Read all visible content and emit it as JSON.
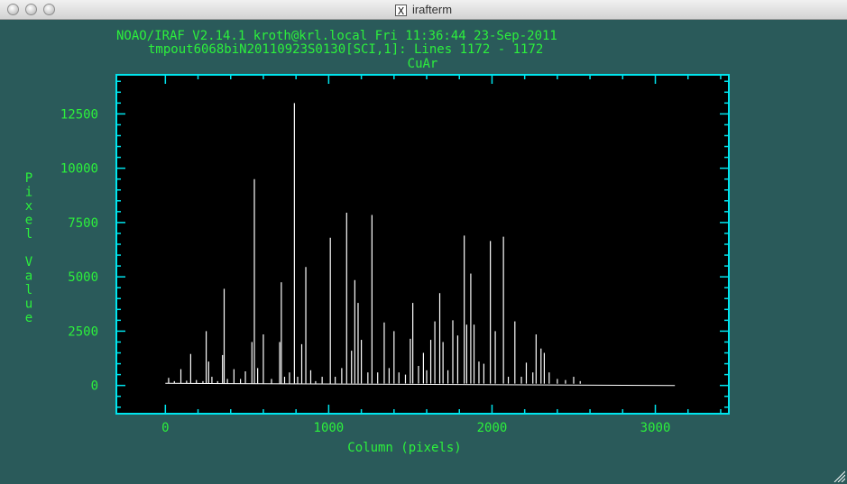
{
  "window": {
    "title": "irafterm",
    "icon": "x11-icon"
  },
  "header": {
    "line1": "NOAO/IRAF V2.14.1 kroth@krl.local Fri 11:36:44 23-Sep-2011",
    "line2": "tmpout6068biN20110923S0130[SCI,1]: Lines 1172 - 1172",
    "line3": "CuAr"
  },
  "colors": {
    "background": "#2a5a5a",
    "text": "#2cf03c",
    "frame": "#00e5ee",
    "plot_bg": "#000000",
    "trace": "#ffffff"
  },
  "chart_data": {
    "type": "line",
    "title": "CuAr",
    "xlabel": "Column (pixels)",
    "ylabel": "Pixel Value",
    "xlim": [
      -300,
      3450
    ],
    "ylim": [
      -1300,
      14300
    ],
    "xticks": [
      0,
      1000,
      2000,
      3000
    ],
    "yticks": [
      0,
      2500,
      5000,
      7500,
      10000,
      12500
    ],
    "grid": false,
    "continuum": [
      [
        0,
        100
      ],
      [
        2600,
        80
      ],
      [
        2650,
        20
      ],
      [
        3120,
        0
      ]
    ],
    "lines": [
      [
        20,
        350
      ],
      [
        55,
        200
      ],
      [
        95,
        750
      ],
      [
        130,
        220
      ],
      [
        155,
        1450
      ],
      [
        190,
        250
      ],
      [
        230,
        200
      ],
      [
        250,
        2500
      ],
      [
        265,
        1100
      ],
      [
        285,
        400
      ],
      [
        320,
        200
      ],
      [
        350,
        1400
      ],
      [
        360,
        4450
      ],
      [
        380,
        300
      ],
      [
        420,
        750
      ],
      [
        460,
        300
      ],
      [
        490,
        650
      ],
      [
        530,
        2000
      ],
      [
        545,
        9500
      ],
      [
        565,
        800
      ],
      [
        600,
        2350
      ],
      [
        650,
        300
      ],
      [
        700,
        2000
      ],
      [
        710,
        4750
      ],
      [
        730,
        400
      ],
      [
        760,
        600
      ],
      [
        790,
        13000
      ],
      [
        810,
        400
      ],
      [
        835,
        1900
      ],
      [
        860,
        5450
      ],
      [
        890,
        700
      ],
      [
        920,
        200
      ],
      [
        960,
        400
      ],
      [
        1010,
        6800
      ],
      [
        1040,
        400
      ],
      [
        1080,
        800
      ],
      [
        1110,
        7950
      ],
      [
        1140,
        1600
      ],
      [
        1160,
        4850
      ],
      [
        1180,
        3800
      ],
      [
        1200,
        2100
      ],
      [
        1240,
        600
      ],
      [
        1265,
        7850
      ],
      [
        1300,
        600
      ],
      [
        1340,
        2900
      ],
      [
        1370,
        800
      ],
      [
        1400,
        2500
      ],
      [
        1430,
        600
      ],
      [
        1470,
        500
      ],
      [
        1500,
        2150
      ],
      [
        1515,
        3800
      ],
      [
        1550,
        900
      ],
      [
        1580,
        1500
      ],
      [
        1600,
        700
      ],
      [
        1625,
        2100
      ],
      [
        1650,
        2950
      ],
      [
        1680,
        4250
      ],
      [
        1700,
        2000
      ],
      [
        1730,
        700
      ],
      [
        1760,
        3000
      ],
      [
        1790,
        2300
      ],
      [
        1830,
        6900
      ],
      [
        1845,
        2800
      ],
      [
        1870,
        5150
      ],
      [
        1890,
        2800
      ],
      [
        1920,
        1100
      ],
      [
        1950,
        1000
      ],
      [
        1990,
        6650
      ],
      [
        2020,
        2500
      ],
      [
        2070,
        6850
      ],
      [
        2100,
        400
      ],
      [
        2140,
        2950
      ],
      [
        2180,
        400
      ],
      [
        2210,
        1050
      ],
      [
        2250,
        600
      ],
      [
        2270,
        2350
      ],
      [
        2300,
        1700
      ],
      [
        2320,
        1500
      ],
      [
        2350,
        600
      ],
      [
        2400,
        300
      ],
      [
        2450,
        250
      ],
      [
        2500,
        400
      ],
      [
        2540,
        200
      ]
    ]
  }
}
